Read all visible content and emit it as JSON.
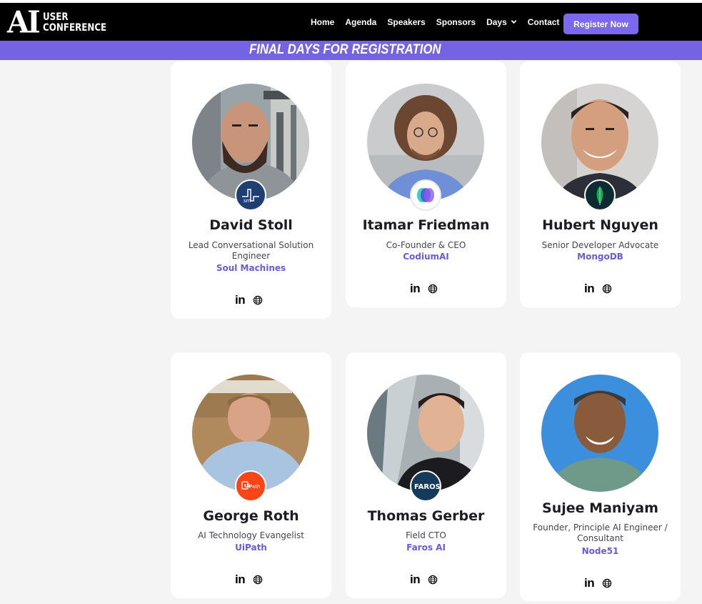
{
  "logo": {
    "mark": "AI",
    "line1": "USER",
    "line2": "CONFERENCE"
  },
  "nav": {
    "items": [
      "Home",
      "Agenda",
      "Speakers",
      "Sponsors",
      "Days",
      "Contact"
    ],
    "register_label": "Register Now"
  },
  "banner": {
    "text": "FINAL DAYS FOR REGISTRATION"
  },
  "speakers": [
    {
      "name": "David Stoll",
      "role": "Lead Conversational Solution Engineer",
      "company": "Soul Machines",
      "badge": "sm",
      "badge_color": "#1f3f73"
    },
    {
      "name": "Itamar Friedman",
      "role": "Co-Founder & CEO",
      "company": "CodiumAI",
      "badge": "codium-logo",
      "badge_color": "#ffffff"
    },
    {
      "name": "Hubert Nguyen",
      "role": "Senior Developer Advocate",
      "company": "MongoDB",
      "badge": "mongodb-leaf",
      "badge_color": "#0f2b32"
    },
    {
      "name": "George Roth",
      "role": "AI Technology Evangelist",
      "company": "UiPath",
      "badge": "UiPath",
      "badge_color": "#fa4616"
    },
    {
      "name": "Thomas Gerber",
      "role": "Field CTO",
      "company": "Faros AI",
      "badge": "FAROS",
      "badge_color": "#163a5a"
    },
    {
      "name": "Sujee Maniyam",
      "role": "Founder, Principle AI Engineer / Consultant",
      "company": "Node51",
      "badge": "",
      "badge_color": ""
    }
  ],
  "social": {
    "linkedin": "in",
    "icons": [
      "linkedin-icon",
      "globe-icon"
    ]
  },
  "colors": {
    "accent": "#7b68ee",
    "banner": "#7464e4",
    "company_text": "#6a5adf",
    "navbar": "#000000"
  }
}
